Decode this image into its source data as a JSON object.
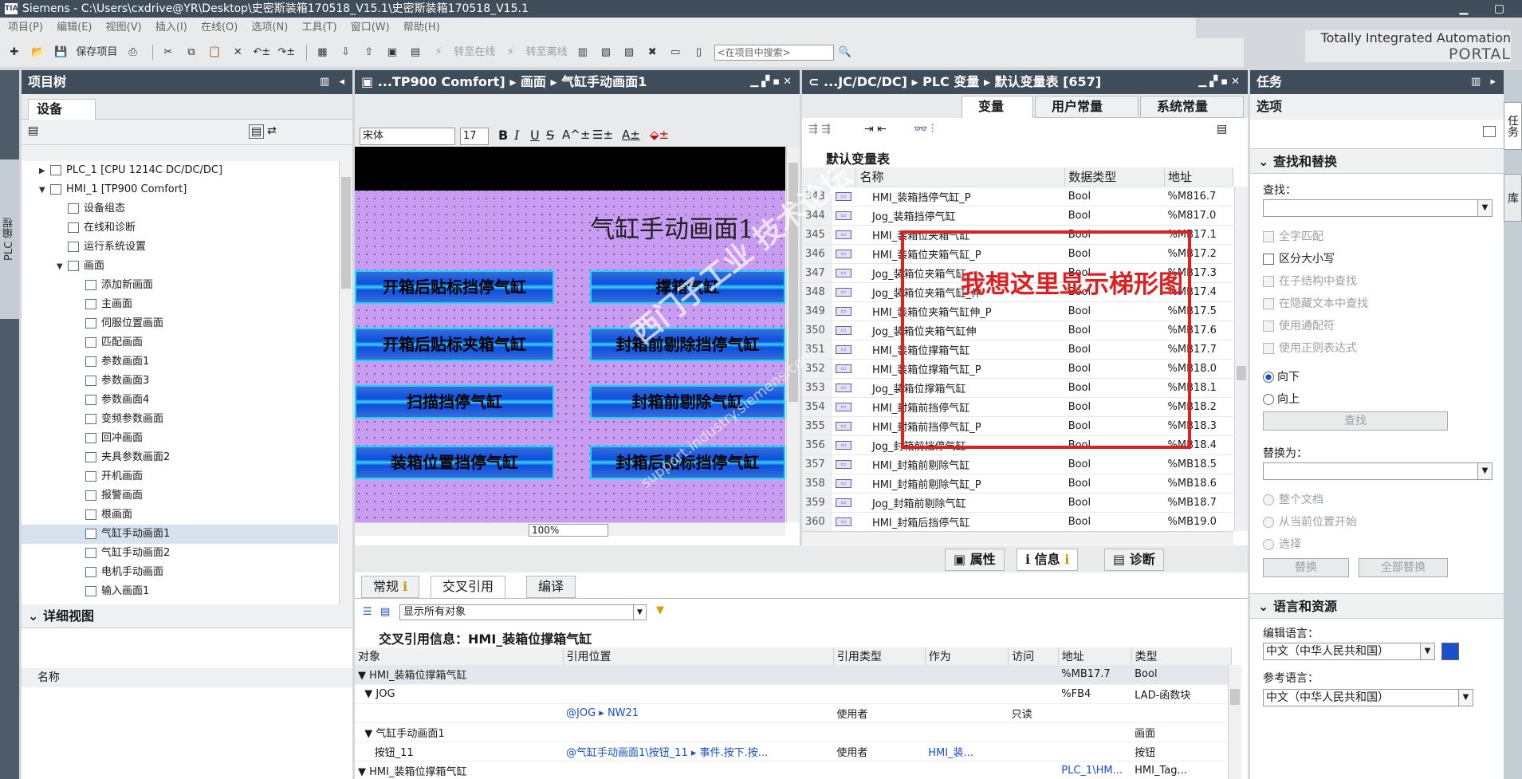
{
  "window": {
    "title": "Siemens  -  C:\\Users\\cxdrive@YR\\Desktop\\史密斯装箱170518_V15.1\\史密斯装箱170518_V15.1",
    "logo": "TIA"
  },
  "menu": [
    "项目(P)",
    "编辑(E)",
    "视图(V)",
    "插入(I)",
    "在线(O)",
    "选项(N)",
    "工具(T)",
    "窗口(W)",
    "帮助(H)"
  ],
  "toolbar": {
    "save_label": "保存项目",
    "go_online": "转至在线",
    "go_offline": "转至离线",
    "search_placeholder": "<在项目中搜索>"
  },
  "brand": {
    "line1": "Totally Integrated Automation",
    "line2": "PORTAL"
  },
  "left_strip": "PLC 编程",
  "project_tree": {
    "title": "项目树",
    "tab": "设备",
    "items": [
      {
        "label": "PLC_1 [CPU 1214C DC/DC/DC]",
        "indent": 1,
        "arrow": "▶"
      },
      {
        "label": "HMI_1 [TP900 Comfort]",
        "indent": 1,
        "arrow": "▼"
      },
      {
        "label": "设备组态",
        "indent": 2,
        "arrow": ""
      },
      {
        "label": "在线和诊断",
        "indent": 2,
        "arrow": ""
      },
      {
        "label": "运行系统设置",
        "indent": 2,
        "arrow": ""
      },
      {
        "label": "画面",
        "indent": 2,
        "arrow": "▼"
      },
      {
        "label": "添加新画面",
        "indent": 3,
        "arrow": ""
      },
      {
        "label": "主画面",
        "indent": 3,
        "arrow": ""
      },
      {
        "label": "伺服位置画面",
        "indent": 3,
        "arrow": ""
      },
      {
        "label": "匹配画面",
        "indent": 3,
        "arrow": ""
      },
      {
        "label": "参数画面1",
        "indent": 3,
        "arrow": ""
      },
      {
        "label": "参数画面3",
        "indent": 3,
        "arrow": ""
      },
      {
        "label": "参数画面4",
        "indent": 3,
        "arrow": ""
      },
      {
        "label": "变频参数画面",
        "indent": 3,
        "arrow": ""
      },
      {
        "label": "回冲画面",
        "indent": 3,
        "arrow": ""
      },
      {
        "label": "夹具参数画面2",
        "indent": 3,
        "arrow": ""
      },
      {
        "label": "开机画面",
        "indent": 3,
        "arrow": ""
      },
      {
        "label": "报警画面",
        "indent": 3,
        "arrow": ""
      },
      {
        "label": "根画面",
        "indent": 3,
        "arrow": ""
      },
      {
        "label": "气缸手动画面1",
        "indent": 3,
        "arrow": "",
        "selected": true
      },
      {
        "label": "气缸手动画面2",
        "indent": 3,
        "arrow": ""
      },
      {
        "label": "电机手动画面",
        "indent": 3,
        "arrow": ""
      },
      {
        "label": "输入画面1",
        "indent": 3,
        "arrow": ""
      }
    ]
  },
  "detail_view": {
    "title": "详细视图",
    "column": "名称"
  },
  "hmi_editor": {
    "breadcrumb": "...TP900 Comfort] ▸ 画面 ▸ 气缸手动画面1",
    "font": "宋体",
    "font_size": "17",
    "zoom": "100%",
    "screen_title": "气缸手动画面1",
    "buttons": [
      "开箱后贴标挡停气缸",
      "撑箱气缸",
      "开箱后贴标夹箱气缸",
      "封箱前剔除挡停气缸",
      "扫描挡停气缸",
      "封箱前剔除气缸",
      "装箱位置挡停气缸",
      "封箱后贴标挡停气缸"
    ]
  },
  "plc_tags": {
    "breadcrumb": "...JC/DC/DC] ▸ PLC 变量 ▸ 默认变量表 [657]",
    "tabs": [
      "变量",
      "用户常量",
      "系统常量"
    ],
    "table_title": "默认变量表",
    "columns": [
      "名称",
      "数据类型",
      "地址"
    ],
    "rows": [
      [
        "343",
        "HMI_装箱挡停气缸_P",
        "Bool",
        "%M816.7"
      ],
      [
        "344",
        "Jog_装箱挡停气缸",
        "Bool",
        "%M817.0"
      ],
      [
        "345",
        "HMI_装箱位夹箱气缸",
        "Bool",
        "%MB17.1"
      ],
      [
        "346",
        "HMI_装箱位夹箱气缸_P",
        "Bool",
        "%MB17.2"
      ],
      [
        "347",
        "Jog_装箱位夹箱气缸",
        "Bool",
        "%MB17.3"
      ],
      [
        "348",
        "Jog_装箱位夹箱气缸_伸",
        "Bool",
        "%MB17.4"
      ],
      [
        "349",
        "HMI_装箱位夹箱气缸伸_P",
        "Bool",
        "%MB17.5"
      ],
      [
        "350",
        "Jog_装箱位夹箱气缸伸",
        "Bool",
        "%MB17.6"
      ],
      [
        "351",
        "HMI_装箱位撑箱气缸",
        "Bool",
        "%MB17.7"
      ],
      [
        "352",
        "HMI_装箱位撑箱气缸_P",
        "Bool",
        "%MB18.0"
      ],
      [
        "353",
        "Jog_装箱位撑箱气缸",
        "Bool",
        "%MB18.1"
      ],
      [
        "354",
        "HMI_封箱前挡停气缸",
        "Bool",
        "%MB18.2"
      ],
      [
        "355",
        "HMI_封箱前挡停气缸_P",
        "Bool",
        "%MB18.3"
      ],
      [
        "356",
        "Jog_封箱前挡停气缸",
        "Bool",
        "%MB18.4"
      ],
      [
        "357",
        "HMI_封箱前剔除气缸",
        "Bool",
        "%MB18.5"
      ],
      [
        "358",
        "HMI_封箱前剔除气缸_P",
        "Bool",
        "%MB18.6"
      ],
      [
        "359",
        "Jog_封箱前剔除气缸",
        "Bool",
        "%MB18.7"
      ],
      [
        "360",
        "HMI_封箱后挡停气缸",
        "Bool",
        "%MB19.0"
      ]
    ]
  },
  "annotation": {
    "text": "我想这里显示梯形图"
  },
  "watermark": {
    "line1": "西门子工业 技术论坛",
    "line2": "support.industry.siemens.com"
  },
  "inspector": {
    "tabs": [
      "属性",
      "信息",
      "诊断"
    ],
    "subtabs": [
      "常规",
      "交叉引用",
      "编译"
    ],
    "filter": "显示所有对象",
    "title": "交叉引用信息：HMI_装箱位撑箱气缸",
    "columns": [
      "对象",
      "引用位置",
      "引用类型",
      "作为",
      "访问",
      "地址",
      "类型"
    ],
    "rows": [
      [
        "▼ HMI_装箱位撑箱气缸",
        "",
        "",
        "",
        "",
        "%MB17.7",
        "Bool"
      ],
      [
        "  ▼ JOG",
        "",
        "",
        "",
        "",
        "%FB4",
        "LAD-函数块"
      ],
      [
        "",
        "@JOG ▸ NW21",
        "使用者",
        "",
        "只读",
        "",
        ""
      ],
      [
        "  ▼ 气缸手动画面1",
        "",
        "",
        "",
        "",
        "",
        "画面"
      ],
      [
        "     按钮_11",
        "@气缸手动画面1\\按钮_11 ▸ 事件.按下.按...",
        "使用者",
        "HMI_装...",
        "",
        "",
        "按钮"
      ],
      [
        "▼ HMI_装箱位撑箱气缸",
        "",
        "",
        "",
        "",
        "PLC_1\\HM...",
        "HMI_Tag..."
      ]
    ]
  },
  "tasks": {
    "title": "任务",
    "options": "选项",
    "find_replace": "查找和替换",
    "find_label": "查找：",
    "checks": [
      "全字匹配",
      "区分大小写",
      "在子结构中查找",
      "在隐藏文本中查找",
      "使用通配符",
      "使用正则表达式"
    ],
    "down": "向下",
    "up": "向上",
    "find_btn": "查找",
    "replace_label": "替换为：",
    "scope": [
      "整个文档",
      "从当前位置开始",
      "选择"
    ],
    "replace_btn": "替换",
    "replace_all_btn": "全部替换",
    "lang_section": "语言和资源",
    "edit_lang": "编辑语言：",
    "edit_lang_val": "中文（中华人民共和国）",
    "ref_lang": "参考语言：",
    "ref_lang_val": "中文（中华人民共和国）"
  },
  "right_strip": [
    "任务",
    "库"
  ]
}
